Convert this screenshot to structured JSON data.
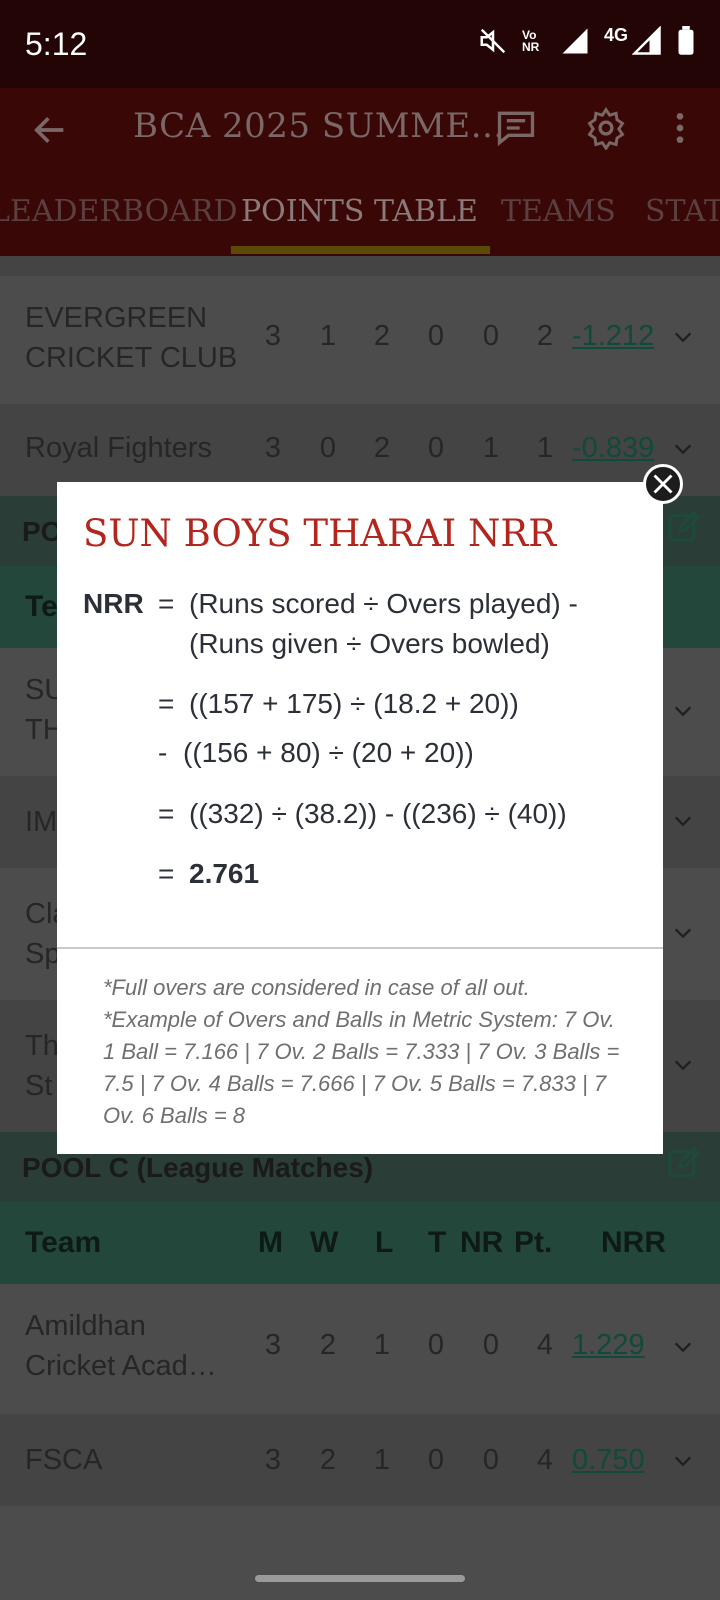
{
  "status_bar": {
    "time": "5:12",
    "volte_label": "Vo NR",
    "network": "4G"
  },
  "app_bar": {
    "title": "BCA 2025 SUMME..."
  },
  "tabs": [
    {
      "label": "LEADERBOARD"
    },
    {
      "label": "POINTS TABLE"
    },
    {
      "label": "TEAMS"
    },
    {
      "label": "STATS"
    }
  ],
  "pool_b_rows": [
    {
      "team": "EVERGREEN\nCRICKET CLUB",
      "m": "3",
      "w": "1",
      "l": "2",
      "t": "0",
      "nr": "0",
      "pt": "2",
      "nrr": "-1.212"
    },
    {
      "team": "Royal Fighters",
      "m": "3",
      "w": "0",
      "l": "2",
      "t": "0",
      "nr": "1",
      "pt": "1",
      "nrr": "-0.839"
    }
  ],
  "partial_rows": [
    {
      "team": "PO"
    },
    {
      "team": "Te"
    },
    {
      "team": "SU\nTH"
    },
    {
      "team": "IM"
    },
    {
      "team": "Cla\nSp"
    },
    {
      "team": "Th\nSt"
    }
  ],
  "pool_c": {
    "title": "POOL C (League Matches)",
    "columns": [
      "Team",
      "M",
      "W",
      "L",
      "T",
      "NR",
      "Pt.",
      "NRR"
    ],
    "rows": [
      {
        "team": "Amildhan\nCricket Acad…",
        "m": "3",
        "w": "2",
        "l": "1",
        "t": "0",
        "nr": "0",
        "pt": "4",
        "nrr": "1.229"
      },
      {
        "team": "FSCA",
        "m": "3",
        "w": "2",
        "l": "1",
        "t": "0",
        "nr": "0",
        "pt": "4",
        "nrr": "0.750"
      }
    ]
  },
  "modal": {
    "title": "SUN BOYS THARAI NRR",
    "label": "NRR",
    "eq_sign": "=",
    "formula_line1": "(Runs scored ÷ Overs played) -",
    "formula_line2": "(Runs given ÷ Overs bowled)",
    "step1_line1": "((157 + 175)  ÷  (18.2 + 20))",
    "step1_minus": "-",
    "step1_line2": "((156 + 80)  ÷  (20 + 20))",
    "step2": "((332)  ÷  (38.2)) - ((236)  ÷  (40))",
    "result": "2.761",
    "note": "*Full overs are considered in case of all out.\n*Example of Overs and Balls in Metric System: 7 Ov. 1 Ball = 7.166 | 7 Ov. 2 Balls = 7.333 | 7 Ov. 3 Balls = 7.5 | 7 Ov. 4 Balls = 7.666 | 7 Ov. 5 Balls = 7.833 | 7 Ov. 6 Balls = 8"
  },
  "colors": {
    "app_bar": "#7a0f0f",
    "title_red": "#b3261e",
    "tab_indicator": "#c9a40f",
    "pool_header": "#5a8a7a",
    "link_green": "#1f8a6a"
  }
}
